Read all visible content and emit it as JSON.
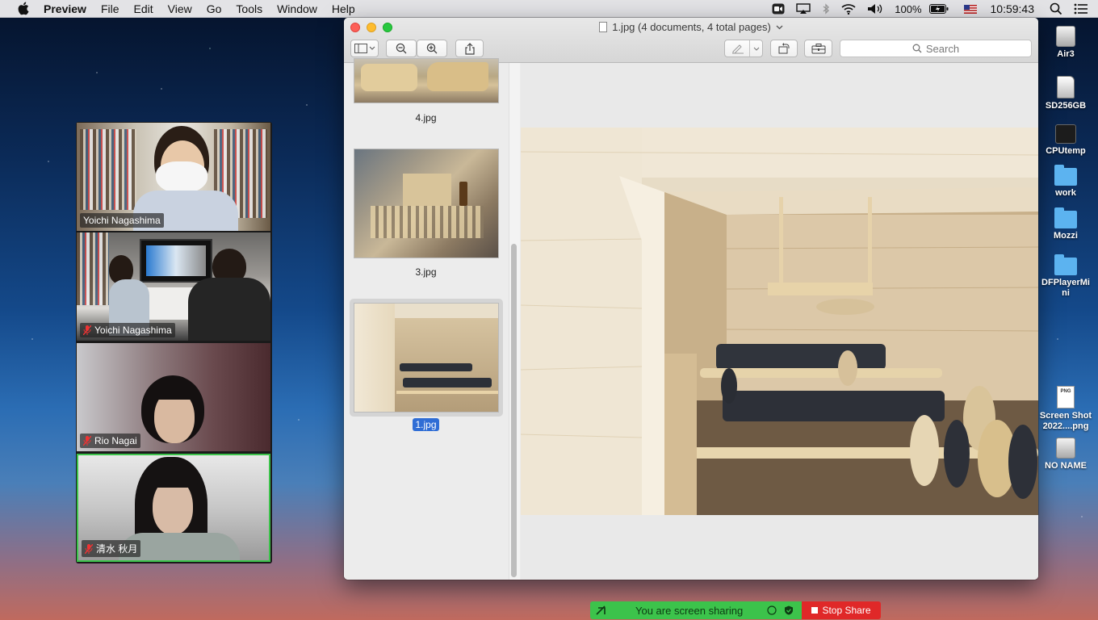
{
  "menubar": {
    "app_name": "Preview",
    "items": [
      "File",
      "Edit",
      "View",
      "Go",
      "Tools",
      "Window",
      "Help"
    ],
    "battery": "100%",
    "clock": "10:59:43"
  },
  "zoom": {
    "participants": [
      {
        "name": "Yoichi Nagashima",
        "muted": false
      },
      {
        "name": "Yoichi Nagashima",
        "muted": true
      },
      {
        "name": "Rio Nagai",
        "muted": true
      },
      {
        "name": "清水 秋月",
        "muted": true,
        "active": true
      }
    ],
    "share_status": "You are screen sharing",
    "stop_share": "Stop Share"
  },
  "preview": {
    "title": "1.jpg (4 documents, 4 total pages)",
    "search_placeholder": "Search",
    "thumbnails": [
      {
        "label": "4.jpg"
      },
      {
        "label": "3.jpg"
      },
      {
        "label": "1.jpg",
        "selected": true
      }
    ]
  },
  "desktop": {
    "icons": [
      "Air3",
      "SD256GB",
      "CPUtemp",
      "work",
      "Mozzi",
      "DFPlayerMi ni",
      "Screen Shot 2022....png",
      "NO NAME"
    ]
  },
  "colors": {
    "zoom_green": "#3cc34b",
    "stop_red": "#e02828",
    "selection_blue": "#2f6dd5"
  }
}
